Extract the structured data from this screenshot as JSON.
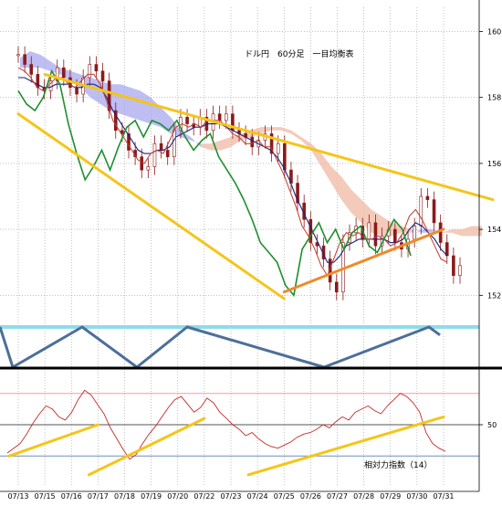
{
  "chart_data": {
    "type": "line",
    "title": "ドル円　60分足　一目均衡表",
    "indicator_label": "相対力指数（14）",
    "x_tick_labels": [
      "07/13",
      "07/15",
      "07/16",
      "07/17",
      "07/18",
      "07/19",
      "07/20",
      "07/22",
      "07/23",
      "07/24",
      "07/25",
      "07/26",
      "07/27",
      "07/28",
      "07/29",
      "07/30",
      "07/31"
    ],
    "price_axis": {
      "ticks": [
        152,
        154,
        156,
        158,
        160
      ],
      "tick_labels": [
        "152",
        "154",
        "156",
        "158",
        "160"
      ],
      "ylim": [
        151.4,
        160.4
      ]
    },
    "rsi_axis": {
      "ticks": [
        50
      ],
      "tick_labels": [
        "50"
      ],
      "levels": [
        30,
        50,
        70
      ],
      "ylim": [
        15,
        85
      ]
    },
    "price_series": {
      "close": [
        159.3,
        159.0,
        158.7,
        158.3,
        158.2,
        158.5,
        158.9,
        158.6,
        158.3,
        158.1,
        158.6,
        159.0,
        158.8,
        158.5,
        157.6,
        157.0,
        156.9,
        156.4,
        156.2,
        155.8,
        155.9,
        156.6,
        156.4,
        156.2,
        157.0,
        157.4,
        157.2,
        157.1,
        157.4,
        157.0,
        157.5,
        157.3,
        157.5,
        157.0,
        156.9,
        156.8,
        156.5,
        156.7,
        156.9,
        156.3,
        156.6,
        155.8,
        155.4,
        154.8,
        154.3,
        153.6,
        153.5,
        153.1,
        152.4,
        152.1,
        153.6,
        153.9,
        154.1,
        153.7,
        154.2,
        153.5,
        153.8,
        154.0,
        153.6,
        153.4,
        153.7,
        154.1,
        155.0,
        154.9,
        154.2,
        153.6,
        153.2,
        152.6,
        152.9
      ],
      "tenkan": [
        158.9,
        158.8,
        158.6,
        158.3,
        158.2,
        158.4,
        158.6,
        158.6,
        158.4,
        158.3,
        158.5,
        158.7,
        158.7,
        158.4,
        157.9,
        157.3,
        157.0,
        156.7,
        156.4,
        156.1,
        156.0,
        156.3,
        156.4,
        156.3,
        156.7,
        157.1,
        157.2,
        157.1,
        157.2,
        157.1,
        157.3,
        157.3,
        157.3,
        157.1,
        156.9,
        156.8,
        156.6,
        156.6,
        156.7,
        156.5,
        156.5,
        156.1,
        155.7,
        155.2,
        154.7,
        154.1,
        153.8,
        153.4,
        152.9,
        152.6,
        153.1,
        153.6,
        153.9,
        153.8,
        153.9,
        153.7,
        153.7,
        153.8,
        153.7,
        153.5,
        153.6,
        153.9,
        154.4,
        154.6,
        154.3,
        153.9,
        153.5,
        153.1,
        153.0
      ],
      "kijun": [
        158.6,
        158.6,
        158.5,
        158.4,
        158.3,
        158.3,
        158.4,
        158.4,
        158.4,
        158.3,
        158.3,
        158.4,
        158.4,
        158.3,
        158.0,
        157.6,
        157.3,
        157.0,
        156.7,
        156.4,
        156.3,
        156.3,
        156.4,
        156.4,
        156.5,
        156.8,
        156.9,
        157.0,
        157.1,
        157.1,
        157.2,
        157.2,
        157.2,
        157.1,
        157.0,
        156.9,
        156.8,
        156.7,
        156.6,
        156.5,
        156.4,
        156.2,
        155.9,
        155.5,
        155.0,
        154.6,
        154.2,
        153.8,
        153.4,
        153.0,
        153.0,
        153.2,
        153.5,
        153.6,
        153.7,
        153.7,
        153.7,
        153.7,
        153.7,
        153.6,
        153.6,
        153.7,
        154.0,
        154.2,
        154.1,
        153.9,
        153.7,
        153.4,
        153.2
      ],
      "chikou": [
        158.2,
        157.8,
        157.6,
        158.0,
        158.8,
        158.4,
        157.2,
        156.3,
        155.5,
        155.9,
        156.4,
        155.8,
        156.5,
        157.1,
        157.3,
        156.8,
        157.3,
        157.2,
        157.0,
        157.3,
        156.8,
        156.4,
        156.7,
        156.9,
        156.2,
        155.8,
        155.4,
        154.9,
        154.3,
        153.6,
        153.3,
        153.0,
        152.3,
        152.0,
        153.4,
        153.8,
        154.2,
        153.6,
        154.0,
        153.4,
        153.9,
        154.1,
        153.5,
        153.3,
        153.8,
        154.3,
        154.0,
        153.2
      ]
    },
    "cloud": {
      "span_a": [
        159.2,
        159.4,
        159.3,
        159.1,
        158.9,
        158.8,
        158.7,
        158.6,
        158.5,
        158.4,
        158.4,
        158.3,
        158.2,
        158.0,
        157.7,
        157.4,
        157.0,
        156.8,
        156.5,
        156.4,
        156.4,
        156.5,
        156.7,
        156.8,
        156.9,
        157.0,
        157.0,
        156.9,
        156.7,
        156.4,
        155.9,
        155.4,
        154.9,
        154.5,
        154.2,
        153.9,
        153.8,
        153.8,
        153.9,
        153.9,
        154.0,
        154.0,
        153.9,
        153.9,
        153.8,
        153.8,
        153.8
      ],
      "span_b": [
        158.9,
        158.9,
        158.9,
        158.8,
        158.7,
        158.5,
        158.3,
        158.0,
        157.8,
        157.6,
        157.5,
        157.4,
        157.3,
        157.2,
        157.1,
        156.9,
        156.8,
        156.7,
        156.6,
        156.6,
        156.7,
        156.8,
        156.9,
        157.0,
        157.1,
        157.1,
        157.1,
        157.0,
        156.8,
        156.6,
        156.3,
        155.9,
        155.6,
        155.2,
        154.9,
        154.6,
        154.4,
        154.2,
        154.1,
        154.0,
        153.9,
        153.9,
        153.9,
        154.0,
        154.0,
        154.1,
        154.1
      ]
    },
    "trend_lines": [
      {
        "from": [
          "07/15",
          158.7
        ],
        "to": [
          "07/31+",
          154.9
        ],
        "color": "#f5c518"
      },
      {
        "from": [
          "07/13",
          157.5
        ],
        "to": [
          "07/25",
          151.9
        ],
        "color": "#f5c518"
      },
      {
        "from": [
          "07/25",
          152.1
        ],
        "to": [
          "07/31",
          154.0
        ],
        "color": "#ee8a2a"
      }
    ],
    "zigzag": [
      1.0,
      0.0,
      1.0,
      0.0,
      1.0,
      0.0,
      1.0,
      0.8
    ],
    "rsi": {
      "values": [
        32,
        35,
        38,
        44,
        51,
        57,
        62,
        60,
        55,
        53,
        58,
        66,
        72,
        69,
        63,
        57,
        48,
        41,
        34,
        28,
        31,
        38,
        44,
        49,
        55,
        61,
        66,
        68,
        63,
        58,
        61,
        67,
        64,
        58,
        54,
        50,
        47,
        43,
        45,
        41,
        38,
        36,
        35,
        37,
        39,
        42,
        44,
        45,
        47,
        50,
        48,
        52,
        55,
        53,
        58,
        60,
        62,
        59,
        57,
        62,
        66,
        70,
        68,
        64,
        58,
        45,
        38,
        35,
        33
      ],
      "trend_lines": [
        {
          "from": [
            "07/13",
            30
          ],
          "to": [
            "07/17",
            50
          ],
          "color": "#f5c518"
        },
        {
          "from": [
            "07/17",
            18
          ],
          "to": [
            "07/22",
            54
          ],
          "color": "#f5c518"
        },
        {
          "from": [
            "07/24",
            18
          ],
          "to": [
            "07/31",
            55
          ],
          "color": "#f5c518"
        }
      ]
    },
    "colors": {
      "background": "#ffffff",
      "price_candle": "#8b1a1a",
      "tenkan": "#c0392b",
      "kijun": "#1a237e",
      "chikou": "#1e8f2e",
      "cloud_up": "#a9a8ee",
      "cloud_down": "#f0b8a3",
      "trend_yellow": "#f5c518",
      "trend_orange": "#ee8a2a",
      "zigzag": "#4d6f99",
      "cyan_band": "#8fdcea",
      "separator": "#000000",
      "rsi_line": "#c62828",
      "rsi_level_70": "#ff9999",
      "rsi_level_50": "#555555",
      "rsi_level_30": "#6e8fbf",
      "grid": "#9a9a9a",
      "text": "#000000"
    }
  }
}
